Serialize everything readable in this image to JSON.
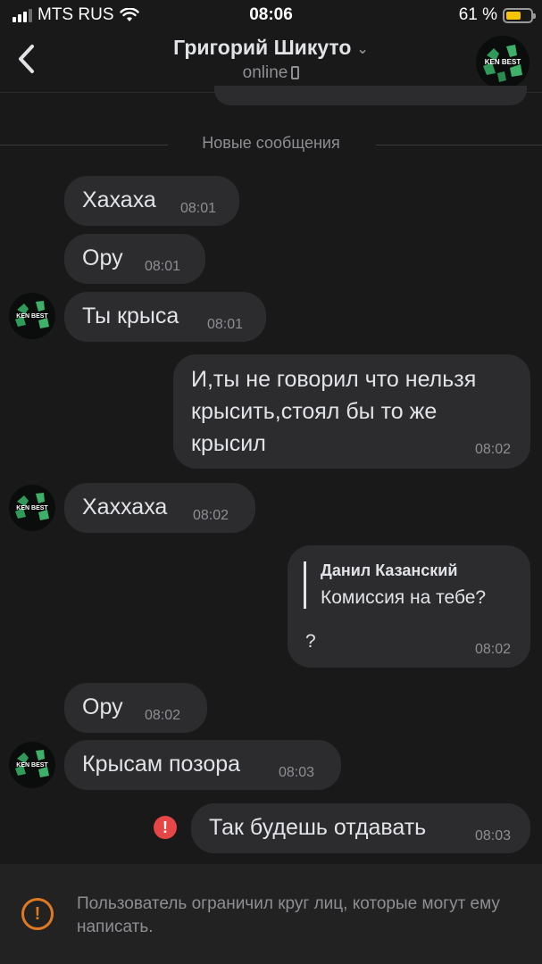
{
  "status_bar": {
    "carrier": "MTS RUS",
    "time": "08:06",
    "battery": "61 %",
    "battery_level": 0.61
  },
  "header": {
    "contact_name": "Григорий Шикуто",
    "presence": "online",
    "avatar_text": "KEN BEST"
  },
  "divider": {
    "label": "Новые сообщения"
  },
  "messages": [
    {
      "text": "Хахаха",
      "time": "08:01"
    },
    {
      "text": "Ору",
      "time": "08:01"
    },
    {
      "text": "Ты крыса",
      "time": "08:01"
    },
    {
      "line1": "И,ты не говорил что нельзя",
      "line2": "крысить,стоял бы то же",
      "line3": "крысил",
      "time": "08:02"
    },
    {
      "text": "Хаххаха",
      "time": "08:02"
    },
    {
      "reply_author": "Данил Казанский",
      "reply_text": "Комиссия на тебе?",
      "text": "?",
      "time": "08:02"
    },
    {
      "text": "Ору",
      "time": "08:02"
    },
    {
      "text": "Крысам позора",
      "time": "08:03"
    },
    {
      "text": "Так будешь отдавать",
      "time": "08:03"
    }
  ],
  "error_icon": "!",
  "footer": {
    "notice": "Пользователь ограничил круг лиц, которые могут ему написать.",
    "icon": "!"
  },
  "colors": {
    "background": "#19191a",
    "bubble": "#2c2c2e",
    "error": "#e64646",
    "warning": "#e07a22"
  }
}
